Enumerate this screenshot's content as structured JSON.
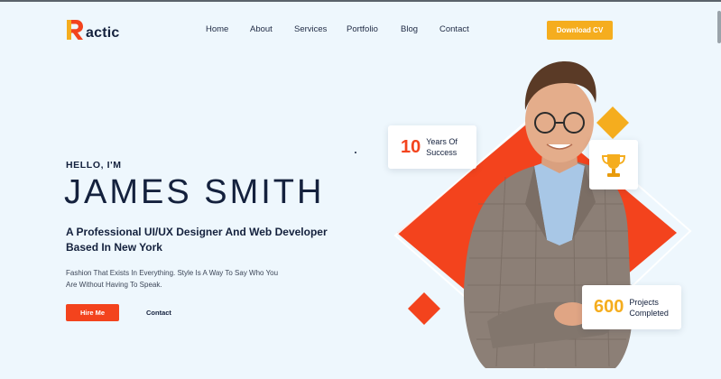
{
  "colors": {
    "accent_red": "#f3431d",
    "accent_yellow": "#f5ad1e",
    "navy": "#14213d",
    "background": "#eef7fd"
  },
  "header": {
    "logo_text": "actic",
    "logo_letter": "R",
    "nav": [
      "Home",
      "About",
      "Services",
      "Portfolio",
      "Blog",
      "Contact"
    ],
    "cta_label": "Download CV"
  },
  "hero": {
    "greeting": "HELLO, I'M",
    "name": "JAMES SMITH",
    "subtitle_line1": "A Professional UI/UX Designer And Web Developer",
    "subtitle_line2": "Based In New York",
    "description_line1": "Fashion That Exists In Everything. Style Is A Way To Say Who You",
    "description_line2": "Are Without Having To Speak.",
    "primary_button": "Hire Me",
    "secondary_button": "Contact"
  },
  "stats": {
    "years": {
      "value": "10",
      "label_line1": "Years Of",
      "label_line2": "Success"
    },
    "projects": {
      "value": "600",
      "label_line1": "Projects",
      "label_line2": "Completed"
    }
  },
  "icons": {
    "trophy": "trophy-icon",
    "logo": "logo-r-icon"
  }
}
